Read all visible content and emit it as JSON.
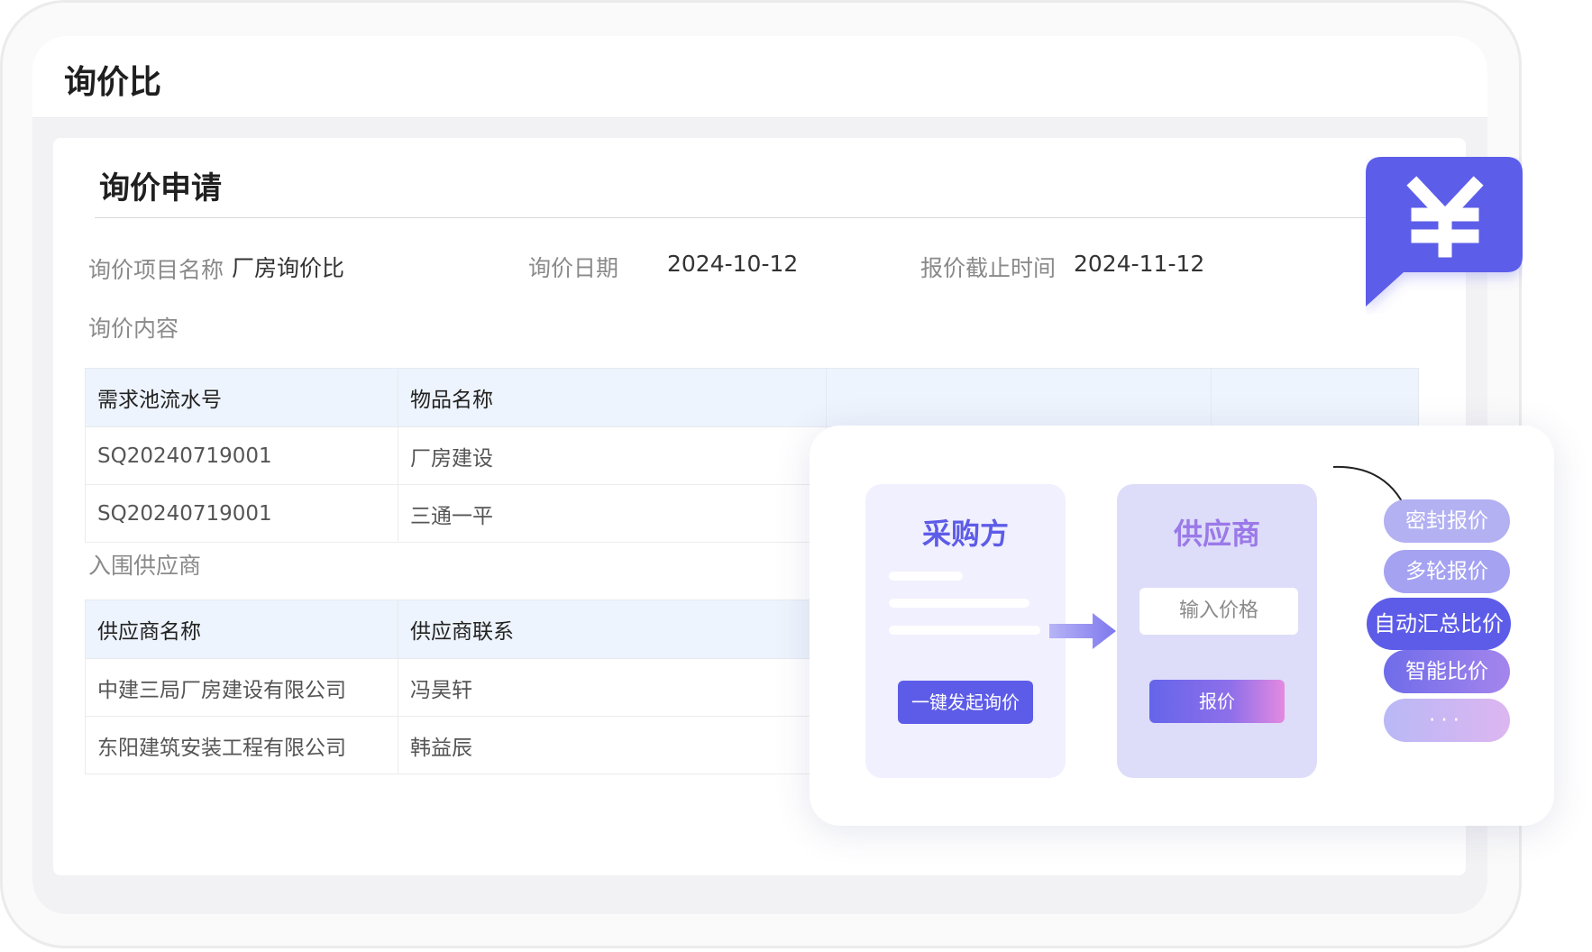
{
  "app": {
    "title": "询价比"
  },
  "section": {
    "title": "询价申请"
  },
  "fields": {
    "project_name_label": "询价项目名称",
    "project_name_value": "厂房询价比",
    "inquiry_date_label": "询价日期",
    "inquiry_date_value": "2024-10-12",
    "deadline_label": "报价截止时间",
    "deadline_value": "2024-11-12",
    "content_label": "询价内容",
    "suppliers_label": "入围供应商"
  },
  "content_table": {
    "headers": [
      "需求池流水号",
      "物品名称",
      "",
      ""
    ],
    "rows": [
      [
        "SQ20240719001",
        "厂房建设"
      ],
      [
        "SQ20240719001",
        "三通一平"
      ]
    ]
  },
  "supplier_table": {
    "headers": [
      "供应商名称",
      "供应商联系"
    ],
    "rows": [
      [
        "中建三局厂房建设有限公司",
        "冯昊轩"
      ],
      [
        "东阳建筑安装工程有限公司",
        "韩益辰"
      ]
    ]
  },
  "badge": {
    "icon": "yen-icon",
    "color": "#5b5de9"
  },
  "flow": {
    "buyer_title": "采购方",
    "buyer_button": "一键发起询价",
    "supplier_title": "供应商",
    "supplier_input_placeholder": "输入价格",
    "supplier_button": "报价",
    "features": [
      "密封报价",
      "多轮报价",
      "自动汇总比价",
      "智能比价",
      "···"
    ]
  },
  "colors": {
    "accent": "#5d5ce8",
    "table_header_bg": "#eef4fd",
    "supplier_title": "#9b79e8"
  }
}
